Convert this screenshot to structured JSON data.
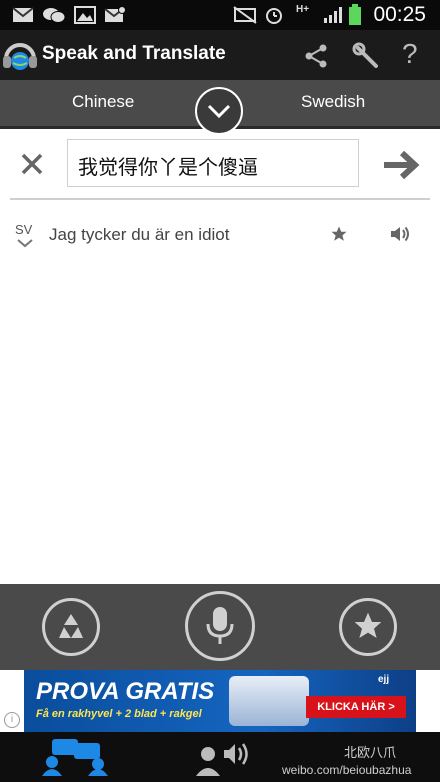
{
  "status_bar": {
    "time": "00:25",
    "network": "H+",
    "icons": [
      "mail-icon",
      "wechat-icon",
      "image-icon",
      "email-alert-icon",
      "mute-icon",
      "alarm-icon",
      "signal-icon",
      "battery-icon"
    ]
  },
  "app": {
    "title": "Speak and Translate",
    "icons": [
      "share-icon",
      "wrench-icon",
      "help-icon"
    ]
  },
  "language_bar": {
    "source": "Chinese",
    "target": "Swedish"
  },
  "input": {
    "value": "我觉得你丫是个傻逼"
  },
  "results": [
    {
      "lang_code": "SV",
      "text": "Jag tycker du är en idiot"
    }
  ],
  "controls": {
    "icons": [
      "recycle-icon",
      "microphone-icon",
      "star-icon"
    ]
  },
  "ad": {
    "title": "PROVA GRATIS",
    "subtitle": "Få en rakhyvel + 2 blad + rakgel",
    "cta": "KLICKA HÄR >",
    "brand": "ejj"
  },
  "bottom_nav": {
    "icons": [
      "conversation-icon",
      "speaker-person-icon"
    ]
  },
  "watermark": {
    "handle": "weibo.com/beioubazhua",
    "name": "北欧八爪"
  },
  "colors": {
    "status_bar": "#0a0a0a",
    "action_bar": "#1b1b1b",
    "language_bar": "#4a4a4a",
    "controls_bar": "#4a4a4a",
    "accent_blue": "#1e88e5",
    "ad_blue": "#1565c0",
    "ad_red": "#d8121a"
  }
}
